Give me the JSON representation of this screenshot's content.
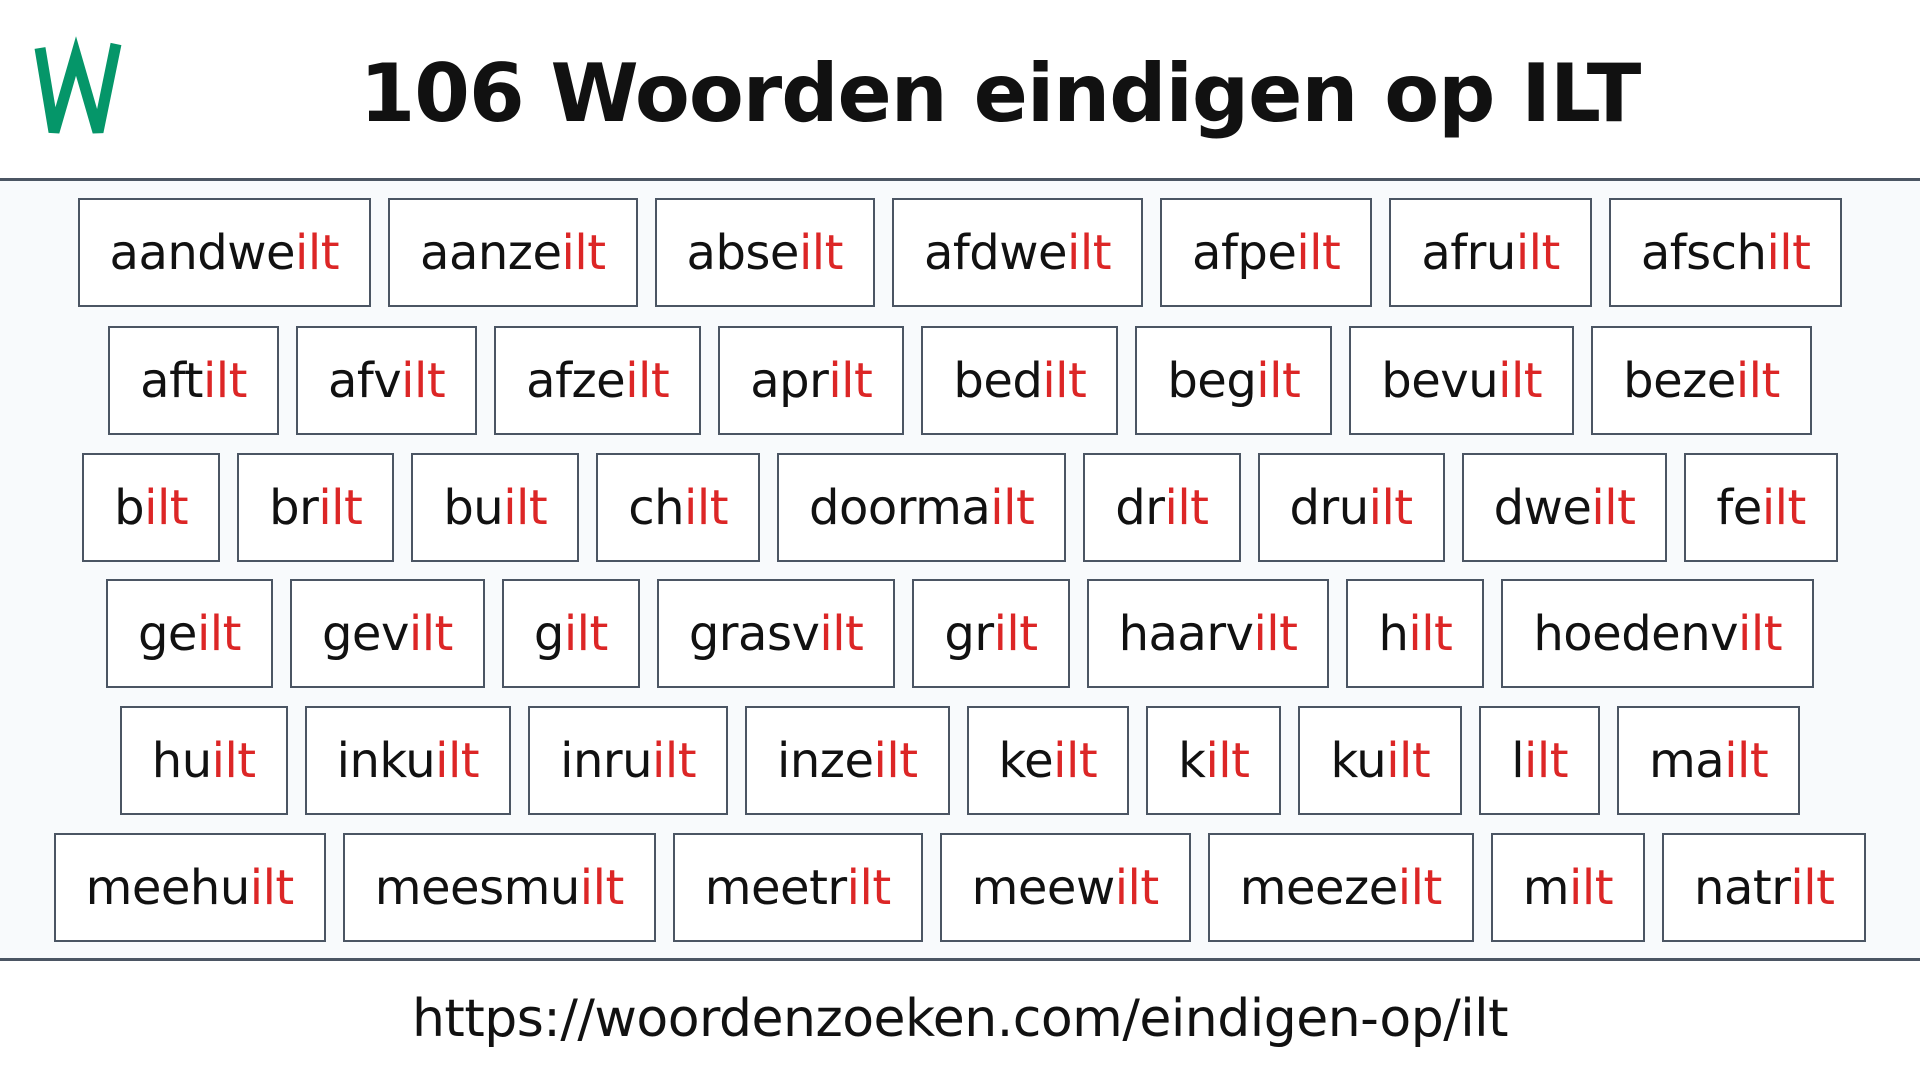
{
  "header": {
    "logo_letter": "W",
    "title": "106 Woorden eindigen op ILT"
  },
  "colors": {
    "brand": "#059669",
    "suffix": "#dc2626",
    "border": "#4b5563",
    "background": "#f8fafc"
  },
  "suffix": "ilt",
  "rows": [
    [
      "aandwe",
      "aanze",
      "abse",
      "afdwe",
      "afpe",
      "afru",
      "afsch"
    ],
    [
      "aft",
      "afv",
      "afze",
      "apr",
      "bed",
      "beg",
      "bevu",
      "beze"
    ],
    [
      "b",
      "br",
      "bu",
      "ch",
      "doorma",
      "dr",
      "dru",
      "dwe",
      "fe"
    ],
    [
      "ge",
      "gev",
      "g",
      "grasv",
      "gr",
      "haarv",
      "h",
      "hoedenv"
    ],
    [
      "hu",
      "inku",
      "inru",
      "inze",
      "ke",
      "k",
      "ku",
      "l",
      "ma"
    ],
    [
      "meehu",
      "meesmu",
      "meetr",
      "meew",
      "meeze",
      "m",
      "natr"
    ]
  ],
  "footer": {
    "url": "https://woordenzoeken.com/eindigen-op/ilt"
  }
}
